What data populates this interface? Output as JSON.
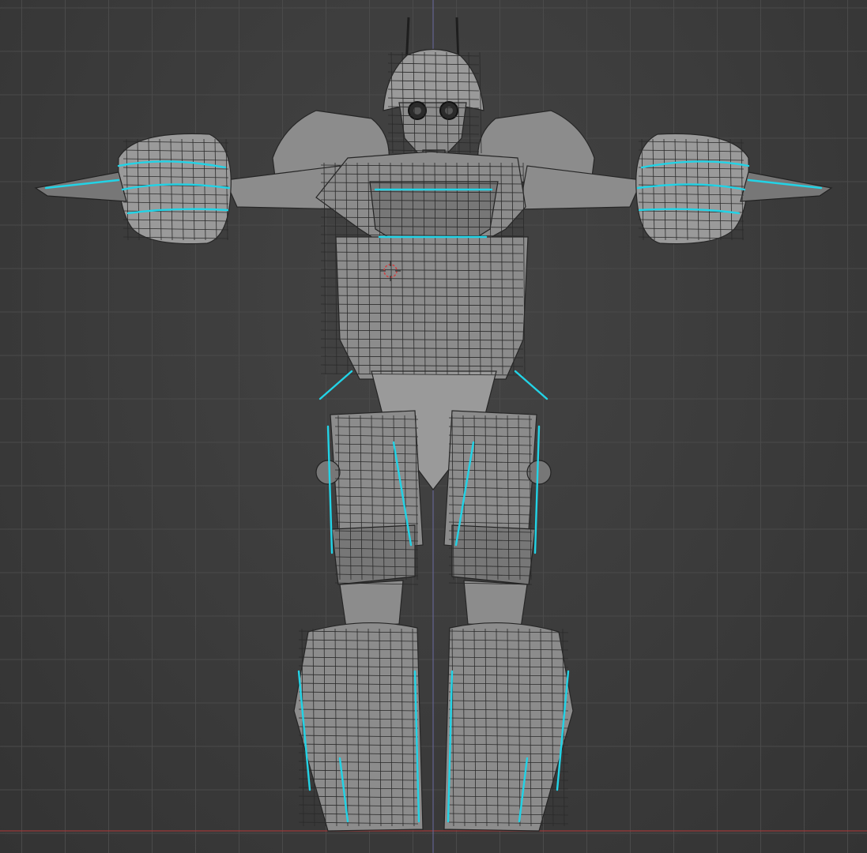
{
  "viewport": {
    "name": "3D Viewport",
    "background_color": "#3c3c3c",
    "grid_color": "#4a4a4a",
    "floor_axis_color": "#9b3a3a",
    "vertical_axis_color": "#6a6aa0"
  },
  "scene": {
    "object": "robot-mesh",
    "display_mode": "wireframe-over-solid",
    "mesh_color": "#8c8c8c",
    "wire_color": "#262626",
    "highlight_color": "#22d3e6",
    "pose": "t-pose"
  },
  "cursor_3d": {
    "icon": "3d-cursor-icon",
    "color": "#d04040"
  }
}
